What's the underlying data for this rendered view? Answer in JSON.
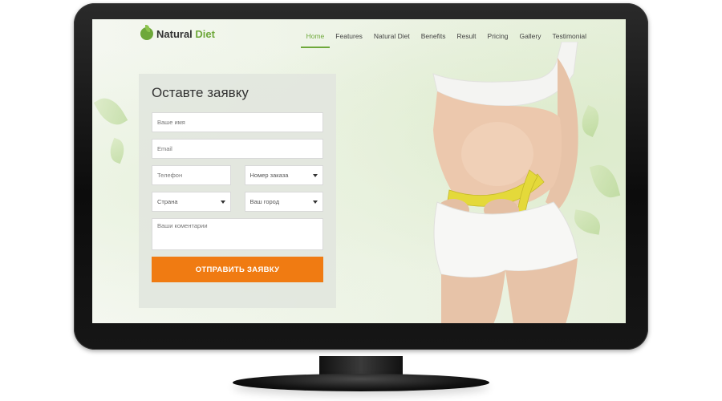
{
  "brand": {
    "name_primary": "Natural",
    "name_accent": "Diet",
    "accent_color": "#6ea83a"
  },
  "nav": {
    "items": [
      {
        "label": "Home",
        "active": true
      },
      {
        "label": "Features",
        "active": false
      },
      {
        "label": "Natural Diet",
        "active": false
      },
      {
        "label": "Benefits",
        "active": false
      },
      {
        "label": "Result",
        "active": false
      },
      {
        "label": "Pricing",
        "active": false
      },
      {
        "label": "Gallery",
        "active": false
      },
      {
        "label": "Testimonial",
        "active": false
      }
    ]
  },
  "form": {
    "title": "Оставте заявку",
    "name_placeholder": "Ваше имя",
    "email_placeholder": "Email",
    "phone_placeholder": "Телефон",
    "order_select": "Номер заказа",
    "country_select": "Страна",
    "city_select": "Ваш город",
    "comment_placeholder": "Ваши коментарии",
    "submit_label": "ОТПРАВИТЬ ЗАЯВКУ",
    "submit_color": "#f07b12"
  },
  "icons": {
    "logo": "leaf-logo-icon",
    "select_caret": "caret-down-icon"
  }
}
